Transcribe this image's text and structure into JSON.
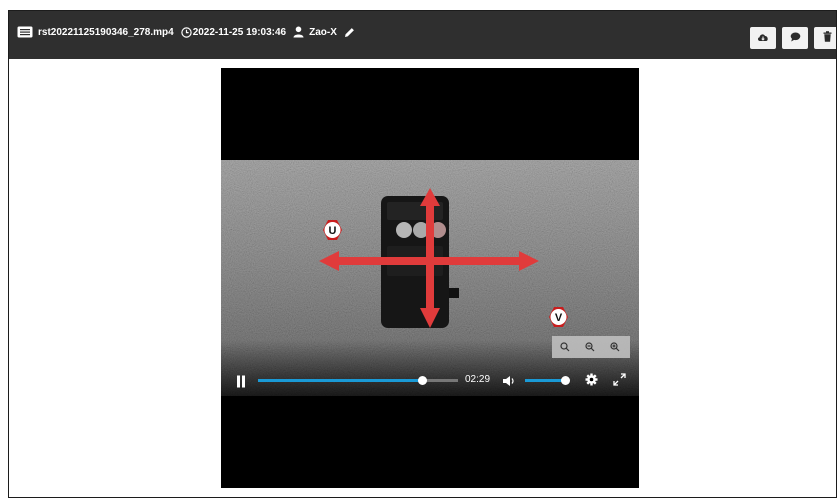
{
  "header": {
    "filename": "rst20221125190346_278.mp4",
    "datetime": "2022-11-25 19:03:46",
    "user": "Zao-X"
  },
  "video": {
    "time": "02:29",
    "progress_fraction": 0.82,
    "volume_fraction": 0.9
  },
  "annotations": {
    "u_label": "U",
    "v_label": "V"
  },
  "icons": {
    "file": "file-icon",
    "clock": "clock-icon",
    "user": "user-icon",
    "edit": "pencil-icon",
    "download": "cloud-download-icon",
    "comment": "comment-icon",
    "delete": "trash-icon"
  },
  "colors": {
    "header_bg": "#2f2f2f",
    "progress": "#1a9ad6",
    "arrow": "#e03b3b"
  }
}
